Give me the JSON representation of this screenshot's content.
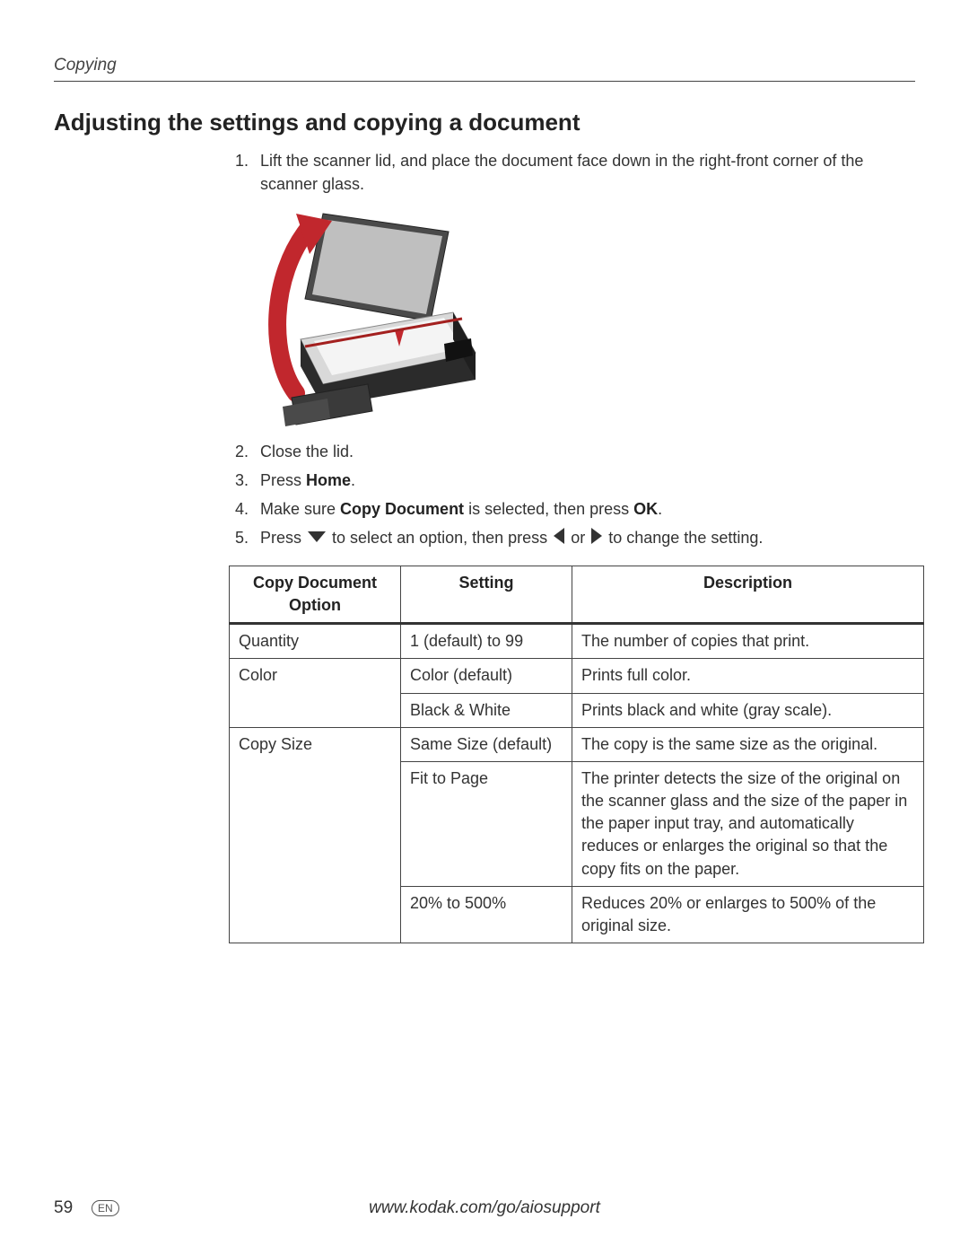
{
  "header": {
    "running": "Copying"
  },
  "title": "Adjusting the settings and copying a document",
  "steps": [
    {
      "n": "1.",
      "before": "Lift the scanner lid, and place the document face down in the right-front corner of the scanner glass."
    },
    {
      "n": "2.",
      "before": "Close the lid."
    },
    {
      "n": "3.",
      "before": "Press ",
      "bold1": "Home",
      "after1": "."
    },
    {
      "n": "4.",
      "before": "Make sure ",
      "bold1": "Copy Document",
      "mid": " is selected, then press ",
      "bold2": "OK",
      "after2": "."
    },
    {
      "n": "5.",
      "before": "Press ",
      "icon1": "down",
      "mid": " to select an option, then press ",
      "icon2": "left",
      "or": " or ",
      "icon3": "right",
      "after2": " to change the setting."
    }
  ],
  "figure": {
    "alt": "Printer with scanner lid open and document placed face down"
  },
  "table": {
    "headers": {
      "c1": "Copy Document Option",
      "c2": "Setting",
      "c3": "Description"
    },
    "rows": [
      {
        "option": "Quantity",
        "setting": "1 (default) to 99",
        "desc": "The number of copies that print."
      },
      {
        "option": "Color",
        "setting": "Color (default)",
        "desc": "Prints full color."
      },
      {
        "option": "",
        "setting": "Black & White",
        "desc": "Prints black and white (gray scale)."
      },
      {
        "option": "Copy Size",
        "setting": "Same Size (default)",
        "desc": "The copy is the same size as the original."
      },
      {
        "option": "",
        "setting": "Fit to Page",
        "desc": "The printer detects the size of the original on the scanner glass and the size of the paper in the paper input tray, and automatically reduces or enlarges the original so that the copy fits on the paper."
      },
      {
        "option": "",
        "setting": "20% to 500%",
        "desc": "Reduces 20% or enlarges to 500% of the original size."
      }
    ]
  },
  "footer": {
    "page": "59",
    "lang": "EN",
    "url": "www.kodak.com/go/aiosupport"
  }
}
